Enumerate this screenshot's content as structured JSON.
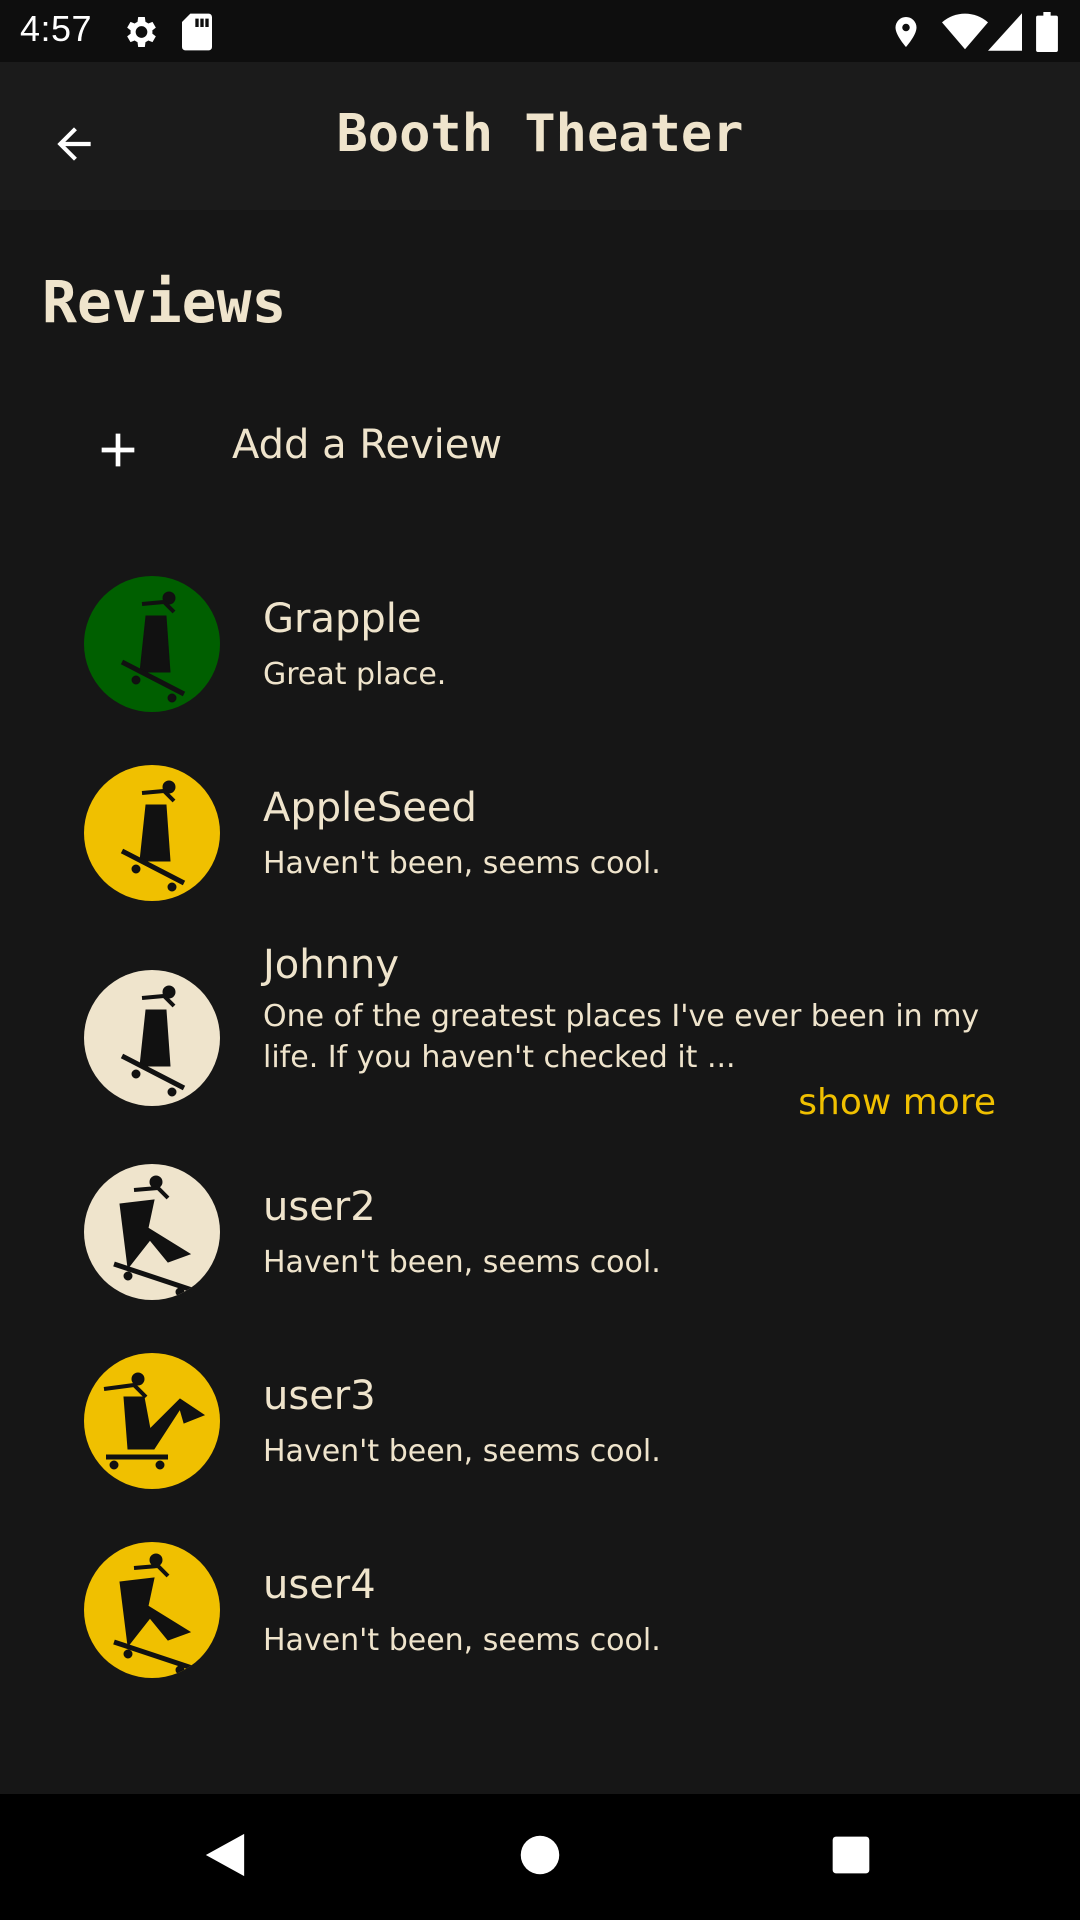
{
  "status_bar": {
    "time": "4:57",
    "left_icons": [
      "gear-icon",
      "sd-card-icon"
    ],
    "right_icons": [
      "location-icon",
      "wifi-icon",
      "signal-icon",
      "battery-icon"
    ]
  },
  "app_bar": {
    "title": "Booth Theater",
    "back_icon": "arrow-back-icon"
  },
  "page": {
    "heading": "Reviews",
    "add_review": {
      "icon": "plus-icon",
      "label": "Add a Review"
    }
  },
  "colors": {
    "background": "#161616",
    "app_bar": "#1b1b1b",
    "text": "#efe4cc",
    "accent_yellow": "#f0c000",
    "accent_green": "#005f00",
    "cream": "#efe4cc"
  },
  "reviews": [
    {
      "name": "Grapple",
      "text": "Great place.",
      "avatar_color": "#005f00",
      "avatar_icon": "skater-icon"
    },
    {
      "name": "AppleSeed",
      "text": "Haven't been, seems cool.",
      "avatar_color": "#f0c000",
      "avatar_icon": "skater-icon"
    },
    {
      "name": "Johnny",
      "text": "One of the greatest places I've ever been in my life. If you haven't checked it ...",
      "avatar_color": "#efe4cc",
      "avatar_icon": "skater-icon",
      "show_more": "show more"
    },
    {
      "name": "user2",
      "text": "Haven't been, seems cool.",
      "avatar_color": "#efe4cc",
      "avatar_icon": "skater-jump-icon"
    },
    {
      "name": "user3",
      "text": "Haven't been, seems cool.",
      "avatar_color": "#f0c000",
      "avatar_icon": "skater-trick-icon"
    },
    {
      "name": "user4",
      "text": "Haven't been, seems cool.",
      "avatar_color": "#f0c000",
      "avatar_icon": "skater-jump-icon"
    }
  ],
  "nav_bar": {
    "back_icon": "nav-back-icon",
    "home_icon": "nav-home-icon",
    "recents_icon": "nav-recents-icon"
  }
}
